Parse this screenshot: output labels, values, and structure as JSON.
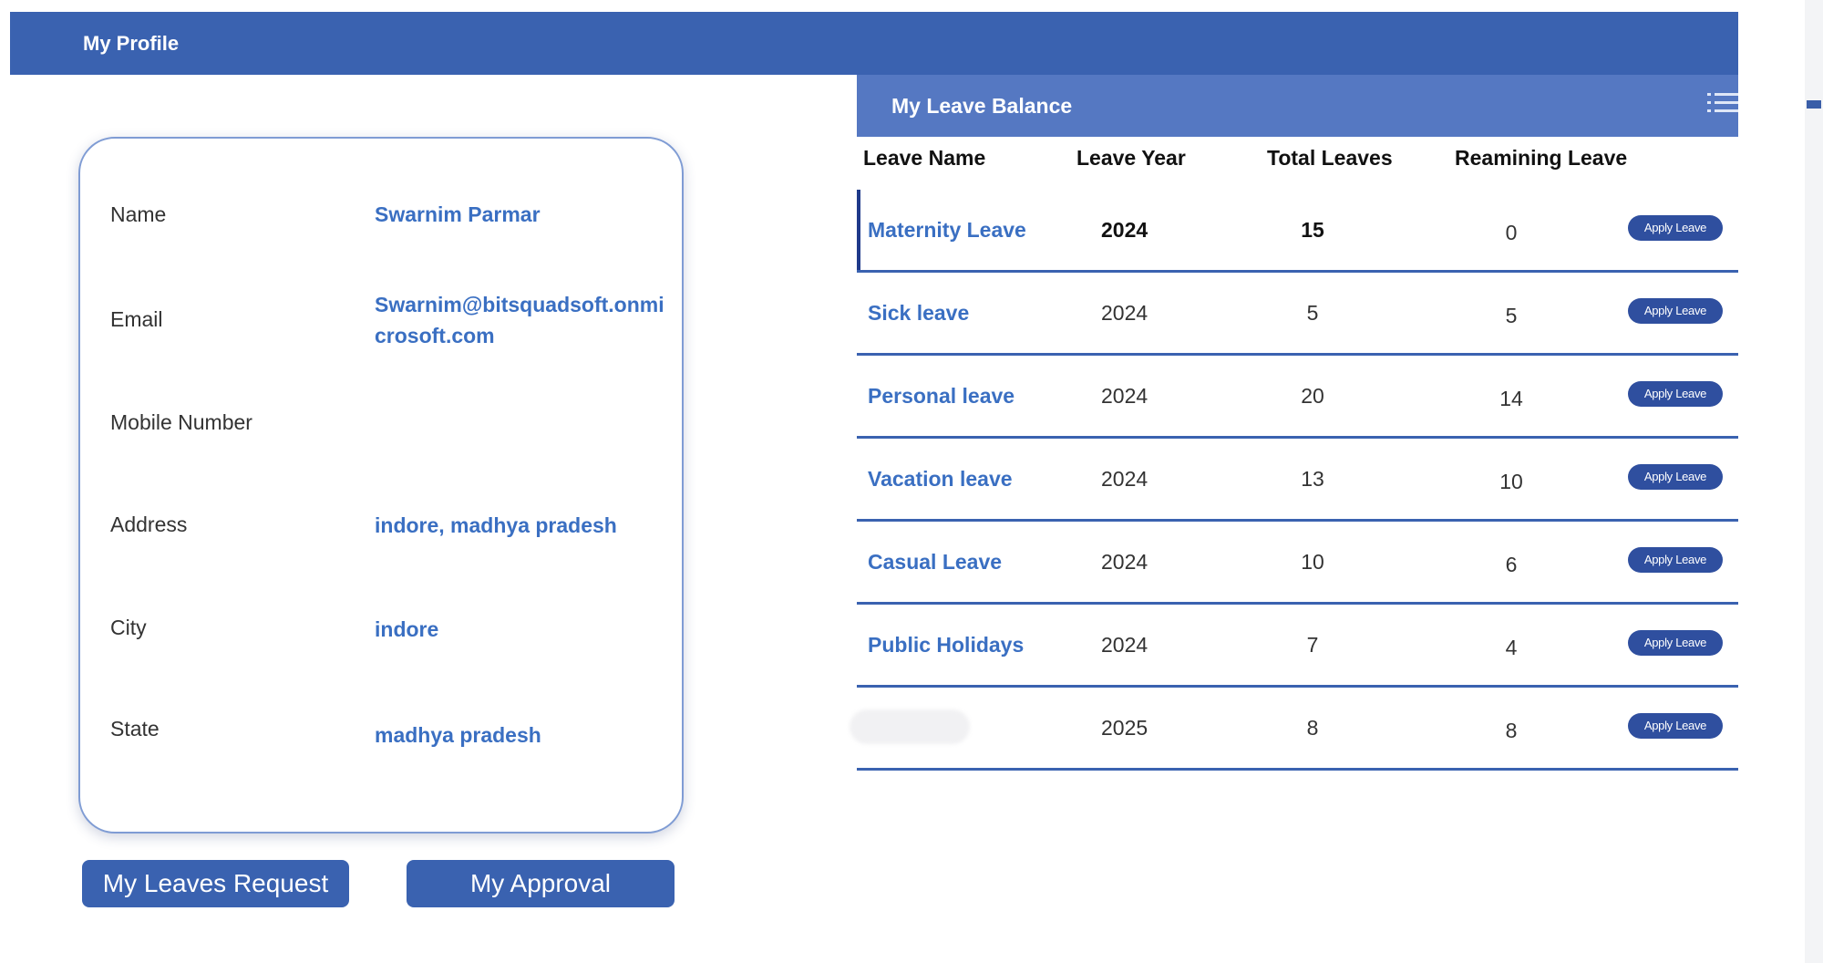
{
  "header": {
    "title": "My Profile"
  },
  "profile": {
    "fields": [
      {
        "label": "Name",
        "value": "Swarnim Parmar"
      },
      {
        "label": "Email",
        "value": "Swarnim@bitsquadsoft.onmicrosoft.com"
      },
      {
        "label": "Mobile Number",
        "value": ""
      },
      {
        "label": "Address",
        "value": "indore, madhya pradesh"
      },
      {
        "label": "City",
        "value": "indore"
      },
      {
        "label": "State",
        "value": "madhya pradesh"
      }
    ]
  },
  "buttons": {
    "my_leaves_request": "My Leaves Request",
    "my_approval": "My Approval"
  },
  "leave_balance": {
    "title": "My Leave Balance",
    "menu_icon": "list-icon",
    "columns": [
      "Leave Name",
      "Leave Year",
      "Total Leaves",
      "Reamining Leave"
    ],
    "apply_label": "Apply Leave",
    "rows": [
      {
        "name": "Maternity Leave",
        "year": "2024",
        "total": "15",
        "remaining": "0"
      },
      {
        "name": "Sick leave",
        "year": "2024",
        "total": "5",
        "remaining": "5"
      },
      {
        "name": "Personal leave",
        "year": "2024",
        "total": "20",
        "remaining": "14"
      },
      {
        "name": "Vacation leave",
        "year": "2024",
        "total": "13",
        "remaining": "10"
      },
      {
        "name": "Casual Leave",
        "year": "2024",
        "total": "10",
        "remaining": "6"
      },
      {
        "name": "Public Holidays",
        "year": "2024",
        "total": "7",
        "remaining": "4"
      },
      {
        "name": "",
        "year": "2025",
        "total": "8",
        "remaining": "8"
      }
    ]
  },
  "colors": {
    "primary": "#3a62b0",
    "header_light": "#5578c2",
    "link": "#3a6fc2",
    "apply_button": "#2f4f9f"
  }
}
